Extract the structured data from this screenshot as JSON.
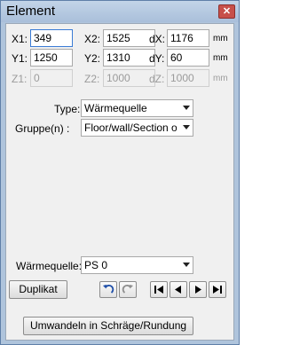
{
  "window": {
    "title": "Element",
    "close_glyph": "✕"
  },
  "coords": {
    "x1_label": "X1:",
    "x1_value": "349",
    "x2_label": "X2:",
    "x2_value": "1525",
    "dx_label": "dX:",
    "dx_value": "1176",
    "dx_unit": "mm",
    "y1_label": "Y1:",
    "y1_value": "1250",
    "y2_label": "Y2:",
    "y2_value": "1310",
    "dy_label": "dY:",
    "dy_value": "60",
    "dy_unit": "mm",
    "z1_label": "Z1:",
    "z1_value": "0",
    "z2_label": "Z2:",
    "z2_value": "1000",
    "dz_label": "dZ:",
    "dz_value": "1000",
    "dz_unit": "mm"
  },
  "type": {
    "label": "Type:",
    "value": "Wärmequelle"
  },
  "gruppe": {
    "label": "Gruppe(n) :",
    "value": "Floor/wall/Section ove"
  },
  "waermequelle": {
    "label": "Wärmequelle:",
    "value": "PS 0"
  },
  "buttons": {
    "duplikat": "Duplikat",
    "umwandeln": "Umwandeln in Schräge/Rundung"
  },
  "icons": {
    "undo": "undo-icon",
    "redo": "redo-icon",
    "first": "first-icon",
    "prev": "previous-icon",
    "next": "next-icon",
    "last": "last-icon"
  }
}
